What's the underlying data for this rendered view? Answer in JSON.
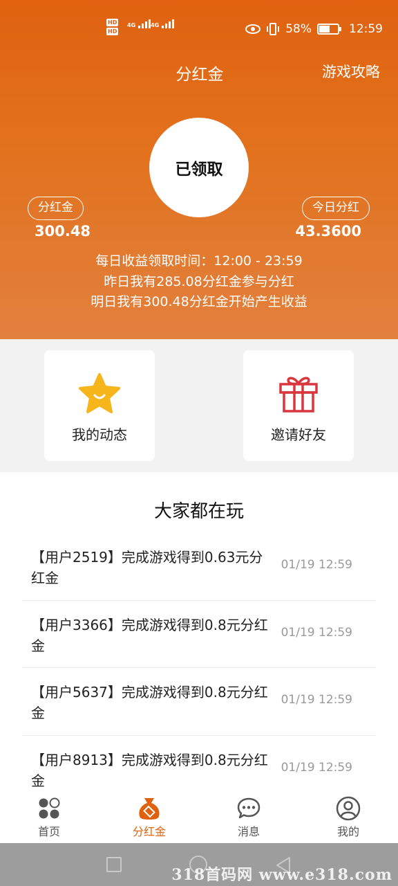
{
  "status_bar": {
    "battery": "58%",
    "time": "12:59",
    "network": "4G",
    "hd_badge": "HD"
  },
  "header": {
    "title": "分红金",
    "guide_link": "游戏攻略"
  },
  "claim": {
    "button_label": "已领取",
    "left_label": "分红金",
    "left_value": "300.48",
    "right_label": "今日分红",
    "right_value": "43.3600",
    "info_lines": [
      "每日收益领取时间：12:00 - 23:59",
      "昨日我有285.08分红金参与分红",
      "明日我有300.48分红金开始产生收益"
    ]
  },
  "actions": [
    {
      "label": "我的动态",
      "icon": "star-smile-icon"
    },
    {
      "label": "邀请好友",
      "icon": "gift-icon"
    }
  ],
  "activity": {
    "title": "大家都在玩",
    "items": [
      {
        "text": "【用户2519】完成游戏得到0.63元分红金",
        "time": "01/19 12:59"
      },
      {
        "text": "【用户3366】完成游戏得到0.8元分红金",
        "time": "01/19 12:59"
      },
      {
        "text": "【用户5637】完成游戏得到0.8元分红金",
        "time": "01/19 12:59"
      },
      {
        "text": "【用户8913】完成游戏得到0.8元分红金",
        "time": "01/19 12:59"
      }
    ]
  },
  "tabs": [
    {
      "label": "首页",
      "icon": "home-dots-icon",
      "active": false
    },
    {
      "label": "分红金",
      "icon": "money-bag-icon",
      "active": true
    },
    {
      "label": "消息",
      "icon": "chat-bubble-icon",
      "active": false
    },
    {
      "label": "我的",
      "icon": "user-profile-icon",
      "active": false
    }
  ],
  "watermark": "318首码网 www.e318.com",
  "colors": {
    "accent": "#e0620f",
    "hero_bottom": "#e2803e",
    "gift_red": "#d9363e",
    "star_yellow": "#f7b51c"
  }
}
